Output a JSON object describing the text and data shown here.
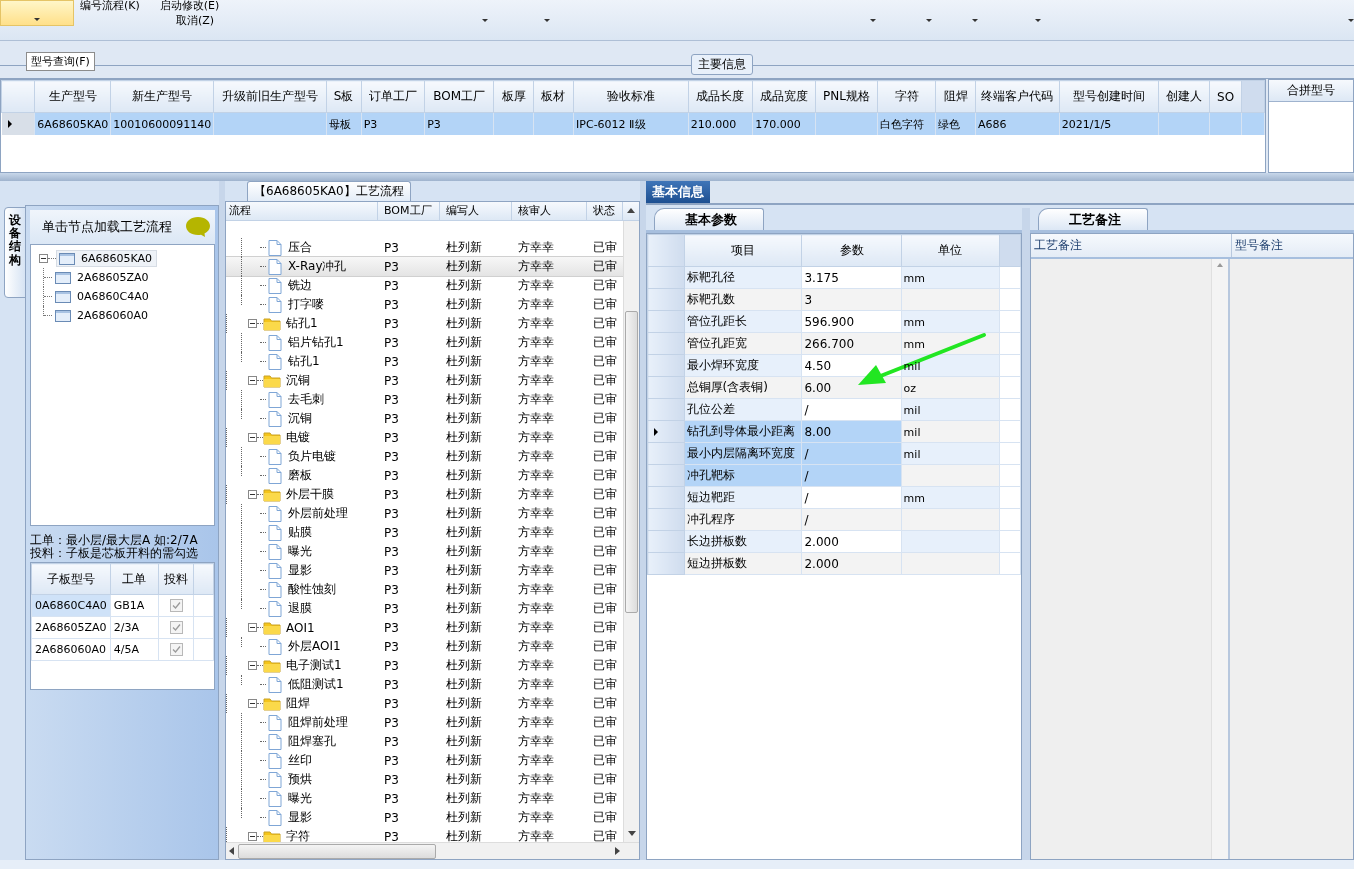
{
  "toolbar": {
    "items": [
      {
        "label": "编号流程(K)"
      },
      {
        "label": "启动修改(E)"
      },
      {
        "label": "取消(Z)"
      }
    ]
  },
  "query_tab": "型号查询(F)",
  "main_info": {
    "legend": "主要信息",
    "columns": [
      "生产型号",
      "新生产型号",
      "升级前旧生产型号",
      "S板",
      "订单工厂",
      "BOM工厂",
      "板厚",
      "板材",
      "验收标准",
      "成品长度",
      "成品宽度",
      "PNL规格",
      "字符",
      "阻焊",
      "终端客户代码",
      "型号创建时间",
      "创建人",
      "SO"
    ],
    "rows": [
      {
        "selected": true,
        "cells": [
          "6A68605KA0",
          "10010600091140",
          "",
          "母板",
          "P3",
          "P3",
          "",
          "",
          "IPC-6012 Ⅱ级",
          "210.000",
          "170.000",
          "",
          "白色字符",
          "绿色",
          "A686",
          "2021/1/5",
          "",
          ""
        ]
      }
    ]
  },
  "merge_panel": {
    "title": "合拼型号"
  },
  "side_tab": "设备结构",
  "structure": {
    "hint": "单击节点加载工艺流程",
    "tree": {
      "label": "6A68605KA0",
      "expanded": true,
      "selected": true,
      "children": [
        {
          "label": "2A68605ZA0",
          "selected": false
        },
        {
          "label": "0A6860C4A0",
          "selected": false
        },
        {
          "label": "2A686060A0",
          "selected": false
        }
      ]
    },
    "notes": [
      "工单：最小层/最大层A 如:2/7A",
      "投料：子板是芯板开料的需勾选"
    ],
    "subboards": {
      "columns": [
        "子板型号",
        "工单",
        "投料"
      ],
      "rows": [
        {
          "board": "0A6860C4A0",
          "order": "GB1A",
          "checked": true,
          "selected": true
        },
        {
          "board": "2A68605ZA0",
          "order": "2/3A",
          "checked": true,
          "selected": false
        },
        {
          "board": "2A686060A0",
          "order": "4/5A",
          "checked": true,
          "selected": false
        }
      ]
    }
  },
  "flow": {
    "title": "【6A68605KA0】工艺流程",
    "columns": [
      "流程",
      "BOM工厂",
      "编写人",
      "核审人",
      "状态"
    ],
    "nodes": [
      {
        "kind": "continued",
        "children": [
          {
            "name": "压合",
            "bom": "P3",
            "author": "杜列新",
            "reviewer": "方幸幸",
            "status": "已审",
            "selected": false
          },
          {
            "name": "X-Ray冲孔",
            "bom": "P3",
            "author": "杜列新",
            "reviewer": "方幸幸",
            "status": "已审",
            "selected": true
          },
          {
            "name": "铣边",
            "bom": "P3",
            "author": "杜列新",
            "reviewer": "方幸幸",
            "status": "已审",
            "selected": false
          },
          {
            "name": "打字嘜",
            "bom": "P3",
            "author": "杜列新",
            "reviewer": "方幸幸",
            "status": "已审",
            "selected": false
          }
        ]
      },
      {
        "kind": "folder",
        "name": "钻孔1",
        "bom": "P3",
        "author": "杜列新",
        "reviewer": "方幸幸",
        "status": "已审",
        "selected": false,
        "expanded": true,
        "children": [
          {
            "name": "铝片钻孔1",
            "bom": "P3",
            "author": "杜列新",
            "reviewer": "方幸幸",
            "status": "已审",
            "selected": false
          },
          {
            "name": "钻孔1",
            "bom": "P3",
            "author": "杜列新",
            "reviewer": "方幸幸",
            "status": "已审",
            "selected": false
          }
        ]
      },
      {
        "kind": "folder",
        "name": "沉铜",
        "bom": "P3",
        "author": "杜列新",
        "reviewer": "方幸幸",
        "status": "已审",
        "selected": false,
        "expanded": true,
        "children": [
          {
            "name": "去毛刺",
            "bom": "P3",
            "author": "杜列新",
            "reviewer": "方幸幸",
            "status": "已审",
            "selected": false
          },
          {
            "name": "沉铜",
            "bom": "P3",
            "author": "杜列新",
            "reviewer": "方幸幸",
            "status": "已审",
            "selected": false
          }
        ]
      },
      {
        "kind": "folder",
        "name": "电镀",
        "bom": "P3",
        "author": "杜列新",
        "reviewer": "方幸幸",
        "status": "已审",
        "selected": false,
        "expanded": true,
        "children": [
          {
            "name": "负片电镀",
            "bom": "P3",
            "author": "杜列新",
            "reviewer": "方幸幸",
            "status": "已审",
            "selected": false
          },
          {
            "name": "磨板",
            "bom": "P3",
            "author": "杜列新",
            "reviewer": "方幸幸",
            "status": "已审",
            "selected": false
          }
        ]
      },
      {
        "kind": "folder",
        "name": "外层干膜",
        "bom": "P3",
        "author": "杜列新",
        "reviewer": "方幸幸",
        "status": "已审",
        "selected": false,
        "expanded": true,
        "children": [
          {
            "name": "外层前处理",
            "bom": "P3",
            "author": "杜列新",
            "reviewer": "方幸幸",
            "status": "已审",
            "selected": false
          },
          {
            "name": "贴膜",
            "bom": "P3",
            "author": "杜列新",
            "reviewer": "方幸幸",
            "status": "已审",
            "selected": false
          },
          {
            "name": "曝光",
            "bom": "P3",
            "author": "杜列新",
            "reviewer": "方幸幸",
            "status": "已审",
            "selected": false
          },
          {
            "name": "显影",
            "bom": "P3",
            "author": "杜列新",
            "reviewer": "方幸幸",
            "status": "已审",
            "selected": false
          },
          {
            "name": "酸性蚀刻",
            "bom": "P3",
            "author": "杜列新",
            "reviewer": "方幸幸",
            "status": "已审",
            "selected": false
          },
          {
            "name": "退膜",
            "bom": "P3",
            "author": "杜列新",
            "reviewer": "方幸幸",
            "status": "已审",
            "selected": false
          }
        ]
      },
      {
        "kind": "folder",
        "name": "AOI1",
        "bom": "P3",
        "author": "杜列新",
        "reviewer": "方幸幸",
        "status": "已审",
        "selected": false,
        "expanded": true,
        "children": [
          {
            "name": "外层AOI1",
            "bom": "P3",
            "author": "杜列新",
            "reviewer": "方幸幸",
            "status": "已审",
            "selected": false
          }
        ]
      },
      {
        "kind": "folder",
        "name": "电子测试1",
        "bom": "P3",
        "author": "杜列新",
        "reviewer": "方幸幸",
        "status": "已审",
        "selected": false,
        "expanded": true,
        "children": [
          {
            "name": "低阻测试1",
            "bom": "P3",
            "author": "杜列新",
            "reviewer": "方幸幸",
            "status": "已审",
            "selected": false
          }
        ]
      },
      {
        "kind": "folder",
        "name": "阻焊",
        "bom": "P3",
        "author": "杜列新",
        "reviewer": "方幸幸",
        "status": "已审",
        "selected": false,
        "expanded": true,
        "children": [
          {
            "name": "阻焊前处理",
            "bom": "P3",
            "author": "杜列新",
            "reviewer": "方幸幸",
            "status": "已审",
            "selected": false
          },
          {
            "name": "阻焊塞孔",
            "bom": "P3",
            "author": "杜列新",
            "reviewer": "方幸幸",
            "status": "已审",
            "selected": false
          },
          {
            "name": "丝印",
            "bom": "P3",
            "author": "杜列新",
            "reviewer": "方幸幸",
            "status": "已审",
            "selected": false
          },
          {
            "name": "预烘",
            "bom": "P3",
            "author": "杜列新",
            "reviewer": "方幸幸",
            "status": "已审",
            "selected": false
          },
          {
            "name": "曝光",
            "bom": "P3",
            "author": "杜列新",
            "reviewer": "方幸幸",
            "status": "已审",
            "selected": false
          },
          {
            "name": "显影",
            "bom": "P3",
            "author": "杜列新",
            "reviewer": "方幸幸",
            "status": "已审",
            "selected": false
          }
        ]
      },
      {
        "kind": "folder",
        "name": "字符",
        "bom": "P3",
        "author": "杜列新",
        "reviewer": "方幸幸",
        "status": "已审",
        "selected": false,
        "expanded": true
      }
    ]
  },
  "info_tab": {
    "label": "基本信息",
    "selected": true
  },
  "params": {
    "tab": "基本参数",
    "columns": [
      "项目",
      "参数",
      "单位"
    ],
    "rows": [
      {
        "item": "标靶孔径",
        "value": "3.175",
        "unit": "mm",
        "selected": false,
        "current": false
      },
      {
        "item": "标靶孔数",
        "value": "3",
        "unit": "",
        "selected": false,
        "current": false
      },
      {
        "item": "管位孔距长",
        "value": "596.900",
        "unit": "mm",
        "selected": false,
        "current": false
      },
      {
        "item": "管位孔距宽",
        "value": "266.700",
        "unit": "mm",
        "selected": false,
        "current": false
      },
      {
        "item": "最小焊环宽度",
        "value": "4.50",
        "unit": "mil",
        "selected": false,
        "current": false
      },
      {
        "item": "总铜厚(含表铜)",
        "value": "6.00",
        "unit": "oz",
        "selected": false,
        "current": false
      },
      {
        "item": "孔位公差",
        "value": "/",
        "unit": "mil",
        "selected": false,
        "current": false
      },
      {
        "item": "钻孔到导体最小距离",
        "value": "8.00",
        "unit": "mil",
        "selected": true,
        "current": true
      },
      {
        "item": "最小内层隔离环宽度",
        "value": "/",
        "unit": "mil",
        "selected": true,
        "current": false
      },
      {
        "item": "冲孔靶标",
        "value": "/",
        "unit": "",
        "selected": true,
        "current": false
      },
      {
        "item": "短边靶距",
        "value": "/",
        "unit": "mm",
        "selected": false,
        "current": false
      },
      {
        "item": "冲孔程序",
        "value": "/",
        "unit": "",
        "selected": false,
        "current": false
      },
      {
        "item": "长边拼板数",
        "value": "2.000",
        "unit": "",
        "selected": false,
        "current": false
      },
      {
        "item": "短边拼板数",
        "value": "2.000",
        "unit": "",
        "selected": false,
        "current": false
      }
    ]
  },
  "remarks": {
    "tab": "工艺备注",
    "columns": [
      "工艺备注",
      "型号备注"
    ]
  }
}
